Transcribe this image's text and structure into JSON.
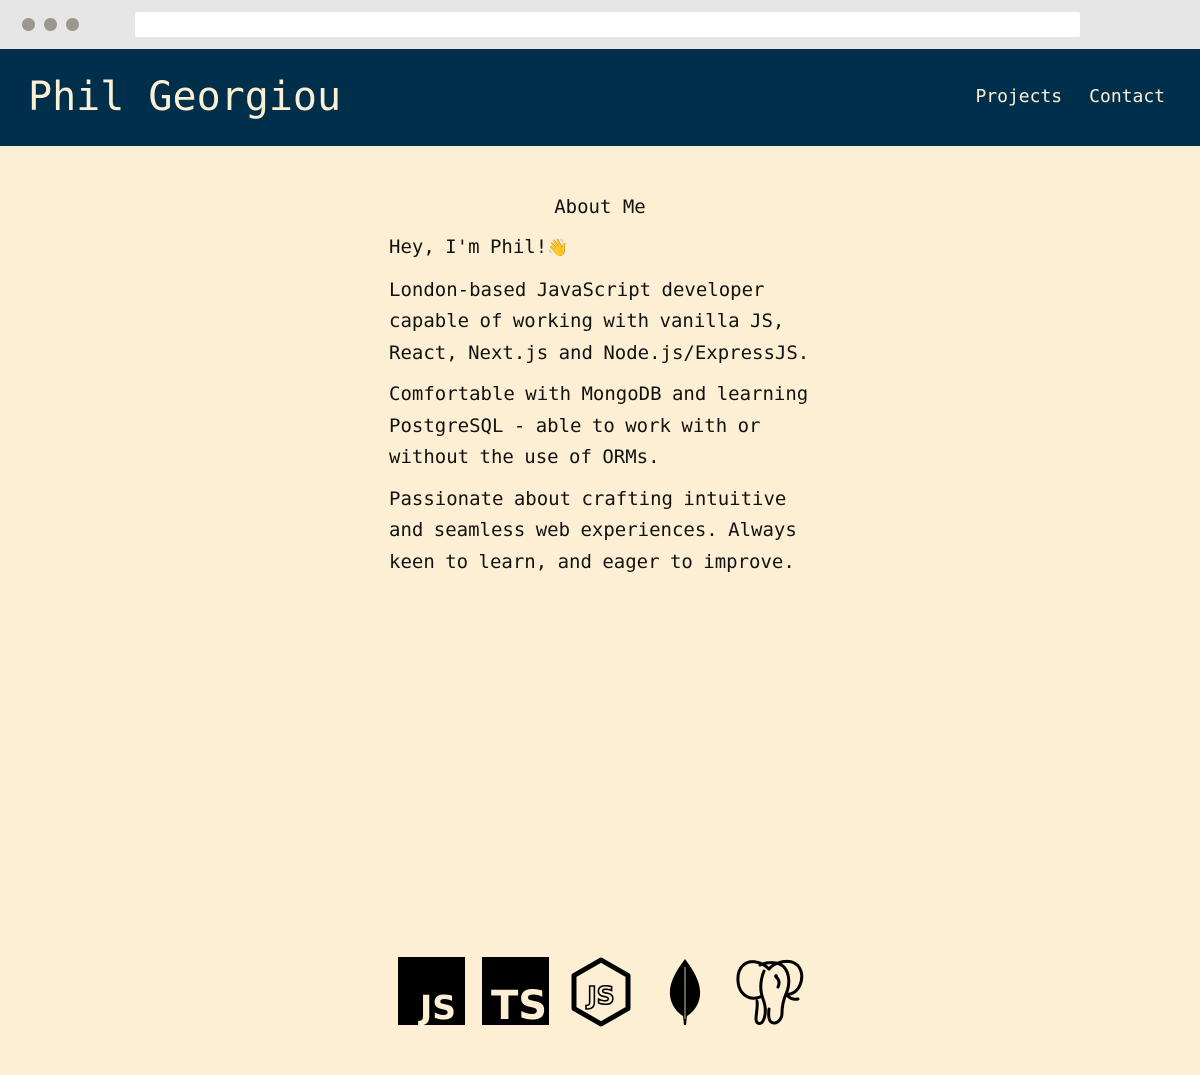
{
  "site": {
    "title": "Phil Georgiou"
  },
  "nav": {
    "items": [
      {
        "label": "Projects"
      },
      {
        "label": "Contact"
      }
    ]
  },
  "about": {
    "heading": "About Me",
    "greeting": "Hey, I'm Phil!",
    "greeting_icon": "waving-hand-icon",
    "paragraphs": [
      "London-based JavaScript developer capable of working with vanilla JS, React, Next.js and Node.js/ExpressJS.",
      "Comfortable with MongoDB and learning PostgreSQL - able to work with or without the use of ORMs.",
      "Passionate about crafting intuitive and seamless web experiences. Always keen to learn, and eager to improve."
    ]
  },
  "tech_icons": [
    {
      "name": "javascript-icon",
      "label": "JS"
    },
    {
      "name": "typescript-icon",
      "label": "TS"
    },
    {
      "name": "nodejs-icon",
      "label": "JS"
    },
    {
      "name": "mongodb-icon"
    },
    {
      "name": "postgresql-icon"
    }
  ],
  "colors": {
    "header_bg": "#002f4b",
    "page_bg": "#fdefd3",
    "header_text": "#fdefd3"
  }
}
